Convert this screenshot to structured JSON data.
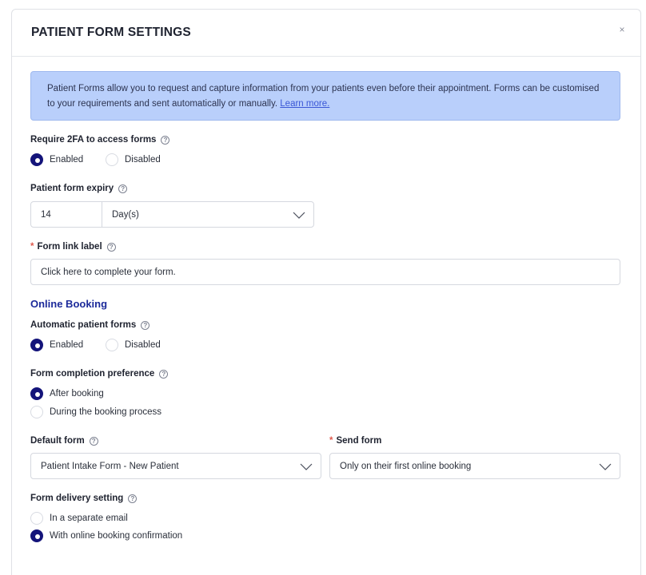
{
  "modal": {
    "title": "PATIENT FORM SETTINGS",
    "close_glyph": "×"
  },
  "info": {
    "text": "Patient Forms allow you to request and capture information from your patients even before their appointment. Forms can be customised to your requirements and sent automatically or manually.",
    "link": "Learn more."
  },
  "require_2fa": {
    "label": "Require 2FA to access forms",
    "options": [
      "Enabled",
      "Disabled"
    ],
    "selected": "Enabled"
  },
  "expiry": {
    "label": "Patient form expiry",
    "value": "14",
    "unit": "Day(s)"
  },
  "link_label": {
    "required_mark": "*",
    "label": "Form link label",
    "value": "Click here to complete your form."
  },
  "online_booking": {
    "title": "Online Booking",
    "automatic": {
      "label": "Automatic patient forms",
      "options": [
        "Enabled",
        "Disabled"
      ],
      "selected": "Enabled"
    },
    "completion": {
      "label": "Form completion preference",
      "options": [
        "After booking",
        "During the booking process"
      ],
      "selected": "After booking"
    },
    "default_form": {
      "label": "Default form",
      "value": "Patient Intake Form - New Patient"
    },
    "send_form": {
      "required_mark": "*",
      "label": "Send form",
      "value": "Only on their first online booking"
    },
    "delivery": {
      "label": "Form delivery setting",
      "options": [
        "In a separate email",
        "With online booking confirmation"
      ],
      "selected": "With online booking confirmation"
    }
  },
  "icons": {
    "help": "?"
  }
}
